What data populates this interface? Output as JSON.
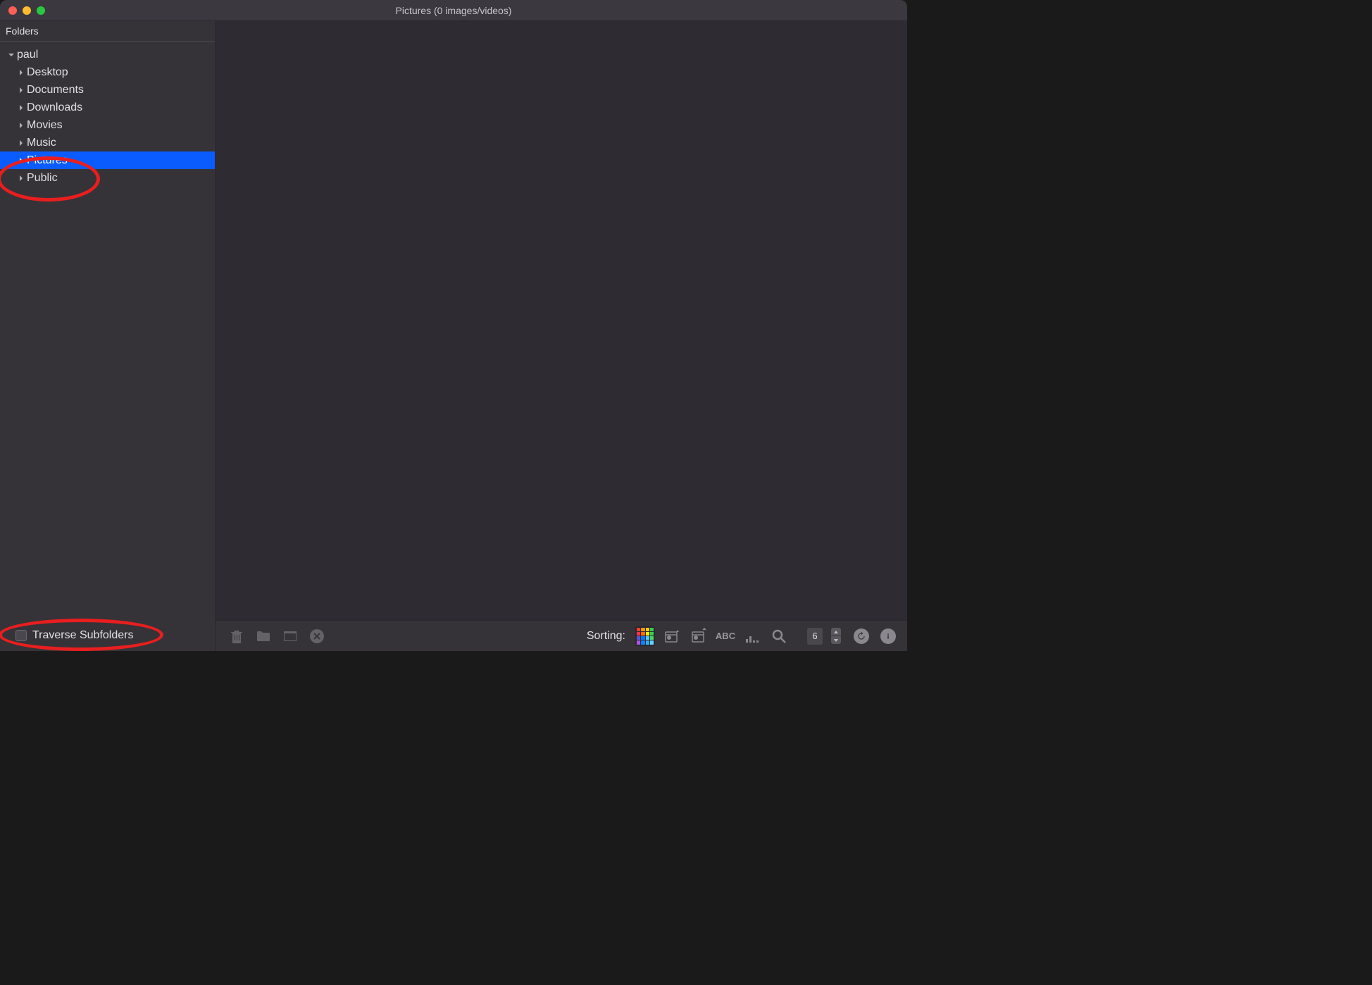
{
  "window": {
    "title": "Pictures (0 images/videos)"
  },
  "sidebar": {
    "header": "Folders",
    "root": {
      "name": "paul",
      "expanded": true
    },
    "items": [
      {
        "name": "Desktop",
        "expanded": false,
        "selected": false
      },
      {
        "name": "Documents",
        "expanded": false,
        "selected": false
      },
      {
        "name": "Downloads",
        "expanded": false,
        "selected": false
      },
      {
        "name": "Movies",
        "expanded": false,
        "selected": false
      },
      {
        "name": "Music",
        "expanded": false,
        "selected": false
      },
      {
        "name": "Pictures",
        "expanded": false,
        "selected": true
      },
      {
        "name": "Public",
        "expanded": false,
        "selected": false
      }
    ],
    "footer": {
      "traverse_label": "Traverse Subfolders",
      "traverse_checked": false
    }
  },
  "bottombar": {
    "sorting_label": "Sorting:",
    "abc_label": "ABC",
    "thumb_size": "6"
  },
  "color_grid": [
    "#ff3b30",
    "#ff9500",
    "#ffcc00",
    "#34c759",
    "#ff2d55",
    "#ff6b00",
    "#ffee00",
    "#30d158",
    "#5856d6",
    "#007aff",
    "#5ac8fa",
    "#4cd964",
    "#af52de",
    "#0a84ff",
    "#32ade6",
    "#64d2ff"
  ]
}
